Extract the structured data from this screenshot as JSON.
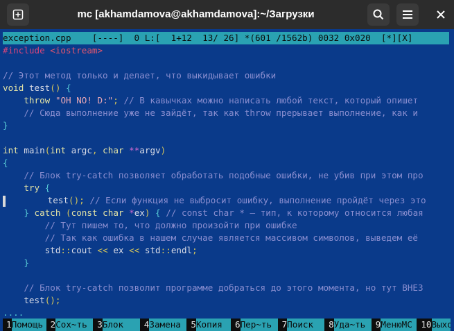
{
  "window": {
    "title": "mc [akhamdamova@akhamdamova]:~/Загрузки",
    "new_tab_icon": "new-tab-icon",
    "search_icon": "search-icon",
    "menu_icon": "hamburger-menu-icon",
    "close_icon": "close-icon"
  },
  "editor": {
    "status": "exception.cpp    [----]  0 L:[  1+12  13/ 26] *(601 /1562b) 0032 0x020  [*][X]",
    "lines": [
      "#include <iostream>",
      "",
      "// Этот метод только и делает, что выкидывает ошибки",
      "void test() {",
      "    throw \"OH NO! D:\"; // В кавычках можно написать любой текст, который опишет",
      "    // Сюда выполнение уже не зайдёт, так как throw прерывает выполнение, как и",
      "}",
      "",
      "int main(int argc, char **argv)",
      "{",
      "    // Блок try-catch позволяет обработать подобные ошибки, не убив при этом про",
      "    try {",
      "        test(); // Если функция не выбросит ошибку, выполнение пройдёт через это",
      "    } catch (const char *ex) { // const char * — тип, к которому относится любая",
      "        // Тут пишем то, что должно произойти при ошибке",
      "        // Так как ошибка в нашем случае является массивом символов, выведем её",
      "        std::cout << ex << std::endl;",
      "    }",
      "",
      "    // Блок try-catch позволит программе добраться до этого момента, но тут ВНЕЗ",
      "    test();",
      "...."
    ]
  },
  "function_keys": [
    {
      "num": "1",
      "label": "Помощь"
    },
    {
      "num": "2",
      "label": "Сох~ть"
    },
    {
      "num": "3",
      "label": "Блок"
    },
    {
      "num": "4",
      "label": "Замена"
    },
    {
      "num": "5",
      "label": "Копия"
    },
    {
      "num": "6",
      "label": "Пер~ть"
    },
    {
      "num": "7",
      "label": "Поиск"
    },
    {
      "num": "8",
      "label": "Уда~ть"
    },
    {
      "num": "9",
      "label": "МенюМС"
    },
    {
      "num": "10",
      "label": "Выход"
    }
  ],
  "colors": {
    "titlebar": "#2c2c2c",
    "editor_background": "#0a3a8a",
    "status_bar": "#2aa2b2",
    "keyword": "#e3e3a6",
    "comment": "#8a8ed0",
    "preprocessor": "#d7457b",
    "string": "#e7a7b6"
  }
}
